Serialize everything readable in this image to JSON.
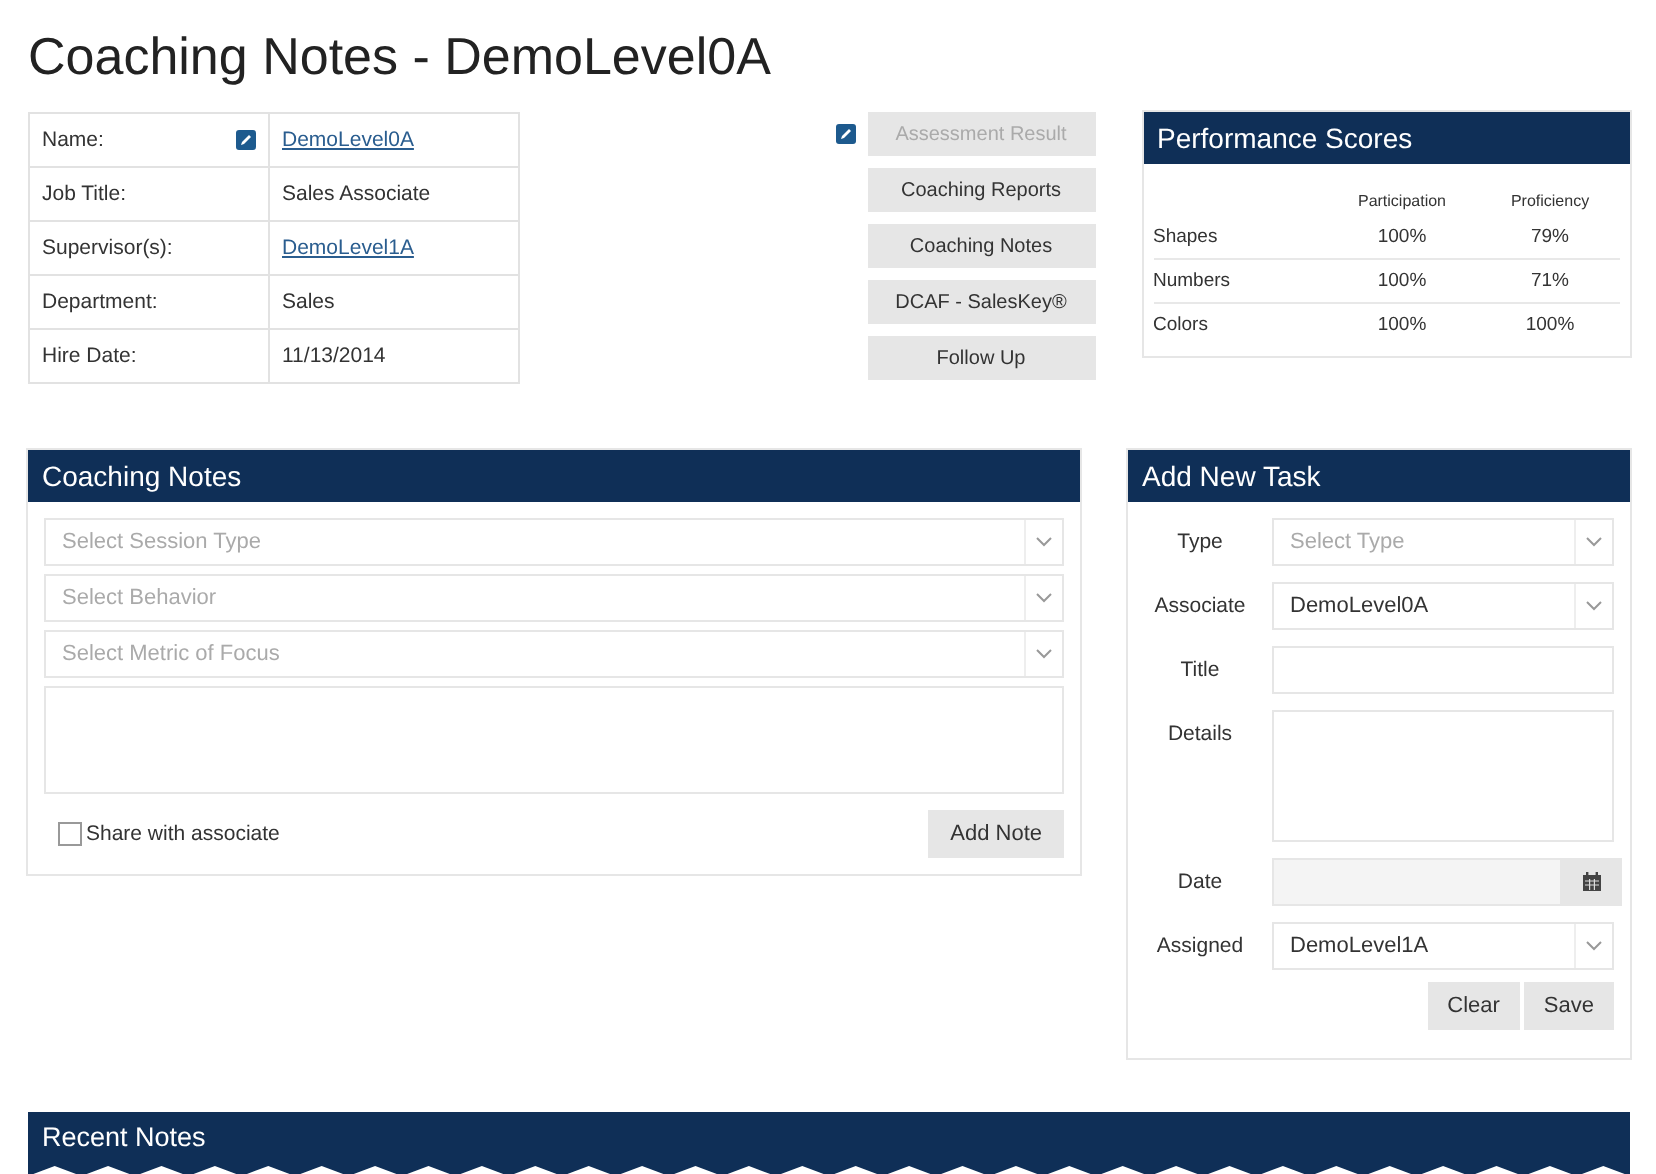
{
  "title": "Coaching Notes - DemoLevel0A",
  "profile": [
    {
      "label": "Name:",
      "value": "DemoLevel0A",
      "kind": "link",
      "editable": true
    },
    {
      "label": "Job Title:",
      "value": "Sales Associate",
      "kind": "text",
      "editable": false
    },
    {
      "label": "Supervisor(s):",
      "value": "DemoLevel1A",
      "kind": "link",
      "editable": false
    },
    {
      "label": "Department:",
      "value": "Sales",
      "kind": "text",
      "editable": false
    },
    {
      "label": "Hire Date:",
      "value": "11/13/2014",
      "kind": "text",
      "editable": false
    }
  ],
  "actions": [
    {
      "label": "Assessment Result",
      "disabled": true,
      "editable": true
    },
    {
      "label": "Coaching Reports",
      "disabled": false,
      "editable": false
    },
    {
      "label": "Coaching Notes",
      "disabled": false,
      "editable": false
    },
    {
      "label": "DCAF - SalesKey®",
      "disabled": false,
      "editable": false
    },
    {
      "label": "Follow Up",
      "disabled": false,
      "editable": false
    }
  ],
  "performance": {
    "title": "Performance Scores",
    "columns": [
      "Participation",
      "Proficiency"
    ],
    "rows": [
      {
        "label": "Shapes",
        "values": [
          "100%",
          "79%"
        ]
      },
      {
        "label": "Numbers",
        "values": [
          "100%",
          "71%"
        ]
      },
      {
        "label": "Colors",
        "values": [
          "100%",
          "100%"
        ]
      }
    ]
  },
  "coaching_notes": {
    "title": "Coaching Notes",
    "selects": [
      {
        "placeholder": "Select Session Type"
      },
      {
        "placeholder": "Select Behavior"
      },
      {
        "placeholder": "Select Metric of Focus"
      }
    ],
    "share": {
      "label": "Share with associate",
      "checked": false
    },
    "button": "Add Note"
  },
  "add_task": {
    "title": "Add New Task",
    "fields": [
      {
        "label": "Type",
        "kind": "select",
        "placeholder": "Select Type"
      },
      {
        "label": "Associate",
        "kind": "select",
        "value": "DemoLevel0A"
      },
      {
        "label": "Title",
        "kind": "text"
      },
      {
        "label": "Details",
        "kind": "textarea"
      },
      {
        "label": "Date",
        "kind": "date"
      },
      {
        "label": "Assigned",
        "kind": "select",
        "value": "DemoLevel1A"
      }
    ],
    "buttons": [
      "Clear",
      "Save"
    ]
  },
  "recent_notes": {
    "title": "Recent Notes"
  }
}
